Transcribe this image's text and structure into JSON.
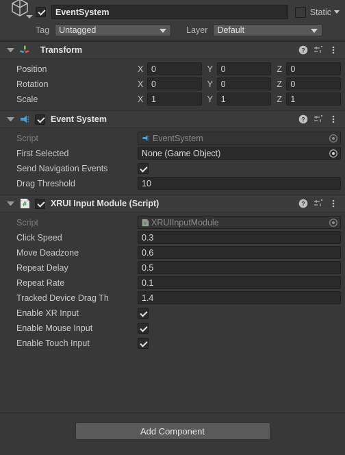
{
  "object_header": {
    "icon": "gameobject-cube-icon",
    "enabled": true,
    "name": "EventSystem",
    "static_label": "Static",
    "static_checked": false,
    "tag_label": "Tag",
    "tag_value": "Untagged",
    "layer_label": "Layer",
    "layer_value": "Default"
  },
  "components": [
    {
      "title": "Transform",
      "icon": "transform-axis-gizmo-icon",
      "has_enable_toggle": false,
      "expanded": true,
      "vectors": [
        {
          "label": "Position",
          "x": "0",
          "y": "0",
          "z": "0"
        },
        {
          "label": "Rotation",
          "x": "0",
          "y": "0",
          "z": "0"
        },
        {
          "label": "Scale",
          "x": "1",
          "y": "1",
          "z": "1"
        }
      ]
    },
    {
      "title": "Event System",
      "icon": "event-system-megaphone-icon",
      "has_enable_toggle": true,
      "enabled": true,
      "expanded": true,
      "fields": [
        {
          "label": "Script",
          "type": "object-readonly",
          "value": "EventSystem",
          "icon": "event-system-megaphone-icon"
        },
        {
          "label": "First Selected",
          "type": "object",
          "value": "None (Game Object)"
        },
        {
          "label": "Send Navigation Events",
          "type": "checkbox",
          "checked": true
        },
        {
          "label": "Drag Threshold",
          "type": "text",
          "value": "10"
        }
      ]
    },
    {
      "title": "XRUI Input Module (Script)",
      "icon": "csharp-script-icon",
      "has_enable_toggle": true,
      "enabled": true,
      "expanded": true,
      "fields": [
        {
          "label": "Script",
          "type": "object-readonly",
          "value": "XRUIInputModule",
          "icon": "csharp-script-icon"
        },
        {
          "label": "Click Speed",
          "type": "text",
          "value": "0.3"
        },
        {
          "label": "Move Deadzone",
          "type": "text",
          "value": "0.6"
        },
        {
          "label": "Repeat Delay",
          "type": "text",
          "value": "0.5"
        },
        {
          "label": "Repeat Rate",
          "type": "text",
          "value": "0.1"
        },
        {
          "label": "Tracked Device Drag Th",
          "type": "text",
          "value": "1.4"
        },
        {
          "label": "Enable XR Input",
          "type": "checkbox",
          "checked": true
        },
        {
          "label": "Enable Mouse Input",
          "type": "checkbox",
          "checked": true
        },
        {
          "label": "Enable Touch Input",
          "type": "checkbox",
          "checked": true
        }
      ]
    }
  ],
  "header_buttons": {
    "help": "help-icon",
    "preset": "preset-settings-icon",
    "menu": "kebab-menu-icon"
  },
  "footer": {
    "add_component_label": "Add Component"
  },
  "colors": {
    "panel_bg": "#383838",
    "header_bg": "#3b3b3b",
    "field_bg": "#2a2a2a",
    "dropdown_bg": "#585858",
    "button_bg": "#5a5a5a",
    "text": "#c9c9c9",
    "text_dim": "#7e7e7e",
    "accent_blue": "#4a9fd4",
    "accent_green": "#4a8f3c"
  }
}
